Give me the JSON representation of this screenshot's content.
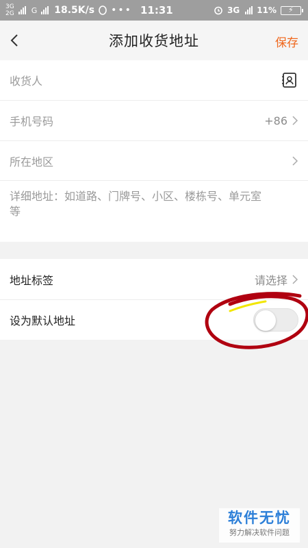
{
  "status_bar": {
    "net_top": "3G",
    "net_bottom": "2G",
    "net_g": "G",
    "speed": "18.5K/s",
    "time": "11:31",
    "net_right": "3G",
    "battery": "11%"
  },
  "nav": {
    "title": "添加收货地址",
    "save_label": "保存"
  },
  "form": {
    "recipient_placeholder": "收货人",
    "phone_placeholder": "手机号码",
    "phone_code": "+86",
    "region_placeholder": "所在地区",
    "address_placeholder": "详细地址：如道路、门牌号、小区、楼栋号、单元室等"
  },
  "options": {
    "tag_label": "地址标签",
    "tag_value": "请选择",
    "default_label": "设为默认地址",
    "default_on": false
  },
  "watermark": {
    "title": "软件无忧",
    "subtitle": "努力解决软件问题"
  },
  "colors": {
    "accent": "#f0671c",
    "annotation": "#b00010"
  }
}
